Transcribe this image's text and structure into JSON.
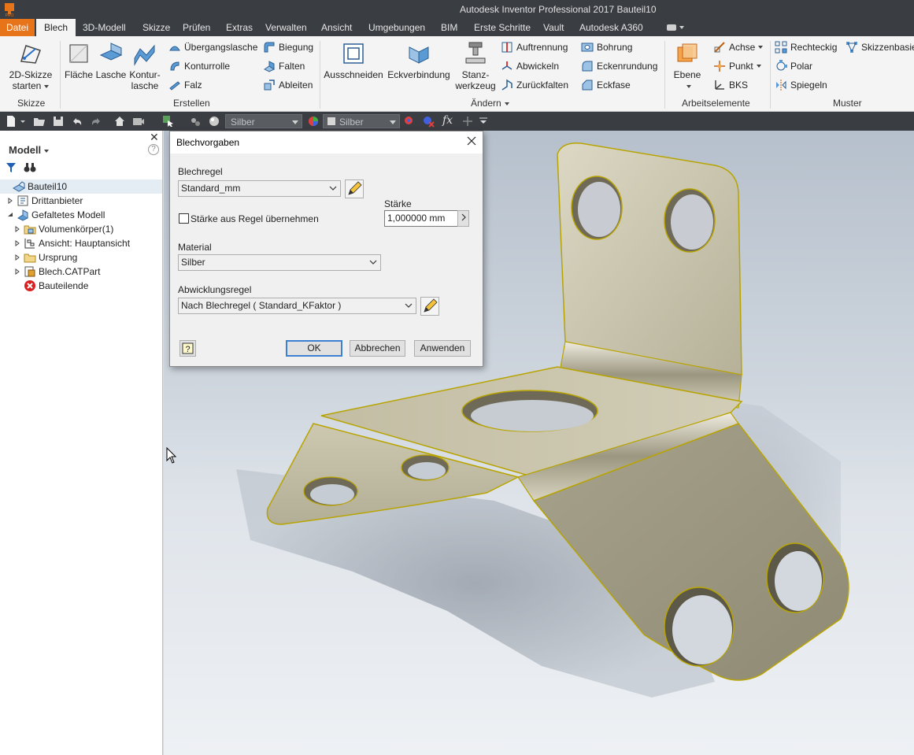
{
  "window": {
    "title": "Autodesk Inventor Professional 2017   Bauteil10"
  },
  "tabs": [
    "Datei",
    "Blech",
    "3D-Modell",
    "Skizze",
    "Prüfen",
    "Extras",
    "Verwalten",
    "Ansicht",
    "Umgebungen",
    "BIM",
    "Erste Schritte",
    "Vault",
    "Autodesk A360"
  ],
  "ribbon": {
    "skizze": {
      "btn_line1": "2D-Skizze",
      "btn_line2": "starten",
      "label": "Skizze"
    },
    "erstellen": {
      "flaeche": "Fläche",
      "lasche": "Lasche",
      "kontur_line1": "Kontur-",
      "kontur_line2": "lasche",
      "uebergangslasche": "Übergangslasche",
      "konturrolle": "Konturrolle",
      "falz": "Falz",
      "biegung": "Biegung",
      "falten": "Falten",
      "ableiten": "Ableiten",
      "label": "Erstellen"
    },
    "aendern": {
      "ausschneiden": "Ausschneiden",
      "eckverbindung": "Eckverbindung",
      "stanz_line1": "Stanz-",
      "stanz_line2": "werkzeug",
      "auftrennung": "Auftrennung",
      "abwickeln": "Abwickeln",
      "zurueckfalten": "Zurückfalten",
      "bohrung": "Bohrung",
      "eckenrundung": "Eckenrundung",
      "eckfase": "Eckfase",
      "label": "Ändern"
    },
    "arbeitselemente": {
      "ebene": "Ebene",
      "achse": "Achse",
      "punkt": "Punkt",
      "bks": "BKS",
      "label": "Arbeitselemente"
    },
    "muster": {
      "rechteckig": "Rechteckig",
      "polar": "Polar",
      "spiegeln": "Spiegeln",
      "skizzenbasiert": "Skizzenbasie",
      "label": "Muster"
    }
  },
  "qat": {
    "material": "Silber",
    "appearance": "Silber",
    "fx": "fx"
  },
  "browser": {
    "title": "Modell",
    "help": "?",
    "tree": [
      {
        "label": "Bauteil10"
      },
      {
        "label": "Drittanbieter"
      },
      {
        "label": "Gefaltetes Modell"
      },
      {
        "label": "Volumenkörper(1)"
      },
      {
        "label": "Ansicht: Hauptansicht"
      },
      {
        "label": "Ursprung"
      },
      {
        "label": "Blech.CATPart"
      },
      {
        "label": "Bauteilende"
      }
    ]
  },
  "dialog": {
    "title": "Blechvorgaben",
    "blechregel_label": "Blechregel",
    "blechregel_value": "Standard_mm",
    "staerke_checkbox": "Stärke aus Regel übernehmen",
    "staerke_label": "Stärke",
    "staerke_value": "1,000000 mm",
    "material_label": "Material",
    "material_value": "Silber",
    "abwicklung_label": "Abwicklungsregel",
    "abwicklung_value": "Nach Blechregel ( Standard_KFaktor )",
    "ok": "OK",
    "abbrechen": "Abbrechen",
    "anwenden": "Anwenden"
  },
  "colors": {
    "file_tab": "#e8741a",
    "dark_chrome": "#3a3d42",
    "ribbon_bg": "#f4f4f4",
    "part": "#c9c4a8",
    "edge": "#b8a400"
  }
}
